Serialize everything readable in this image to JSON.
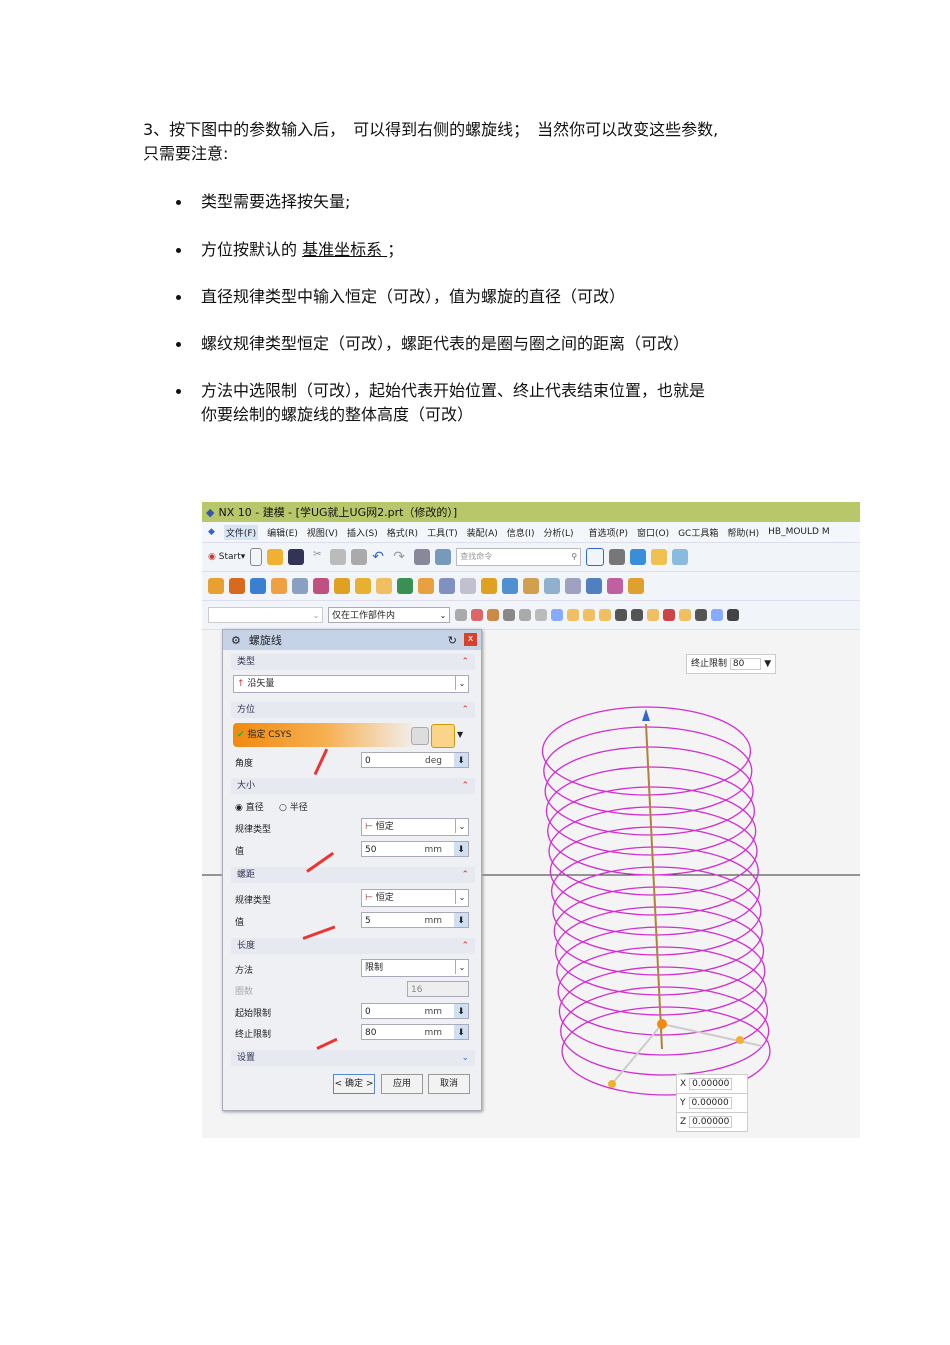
{
  "doc": {
    "intro": [
      "3、按下图中的参数输入后，　可以得到右侧的螺旋线；　当然你可以改变这些参数,",
      "只需要注意:"
    ],
    "bullets": [
      {
        "text": "类型需要选择按矢量;"
      },
      {
        "pre": "方位按默认的 ",
        "link": "基准坐标系 ",
        "post": "；"
      },
      {
        "text": "直径规律类型中输入恒定（可改），值为螺旋的直径（可改）"
      },
      {
        "text": "螺纹规律类型恒定（可改），螺距代表的是圈与圈之间的距离（可改）"
      },
      {
        "text": "方法中选限制（可改），起始代表开始位置、终止代表结束位置，也就是",
        "text2": "你要绘制的螺旋线的整体高度（可改）"
      }
    ]
  },
  "app": {
    "title": "NX 10 - 建模 - [学UG就上UG网2.prt（修改的）]",
    "menu": [
      "文件(F)",
      "编辑(E)",
      "视图(V)",
      "插入(S)",
      "格式(R)",
      "工具(T)",
      "装配(A)",
      "信息(I)",
      "分析(L)",
      "首选项(P)",
      "窗口(O)",
      "GC工具箱",
      "帮助(H)",
      "HB_MOULD M"
    ],
    "start": "Start",
    "search_placeholder": "查找命令",
    "filter": "仅在工作部件内"
  },
  "dialog": {
    "title": "螺旋线",
    "type_section": "类型",
    "type_value": "沿矢量",
    "orient_section": "方位",
    "csys": "指定 CSYS",
    "angle_label": "角度",
    "angle_value": "0",
    "angle_unit": "deg",
    "size_section": "大小",
    "diameter": "直径",
    "radius": "半径",
    "law_label": "规律类型",
    "law_value": "恒定",
    "value_label": "值",
    "diameter_value": "50",
    "mm": "mm",
    "pitch_section": "螺距",
    "pitch_law_label": "规律类型",
    "pitch_law_value": "恒定",
    "pitch_value_label": "值",
    "pitch_value": "5",
    "length_section": "长度",
    "method_label": "方法",
    "method_value": "限制",
    "turns_label": "圈数",
    "turns_value": "16",
    "start_label": "起始限制",
    "start_value": "0",
    "end_label": "终止限制",
    "end_value": "80",
    "settings_section": "设置",
    "ok": "< 确定 >",
    "apply": "应用",
    "cancel": "取消"
  },
  "viewport": {
    "end_tag_label": "终止限制",
    "end_tag_value": "80",
    "x_label": "X",
    "x_value": "0.00000",
    "y_label": "Y",
    "y_value": "0.00000",
    "z_label": "Z",
    "z_value": "0.00000",
    "helix_turns": 16,
    "helix_color": "#d22ed2"
  }
}
